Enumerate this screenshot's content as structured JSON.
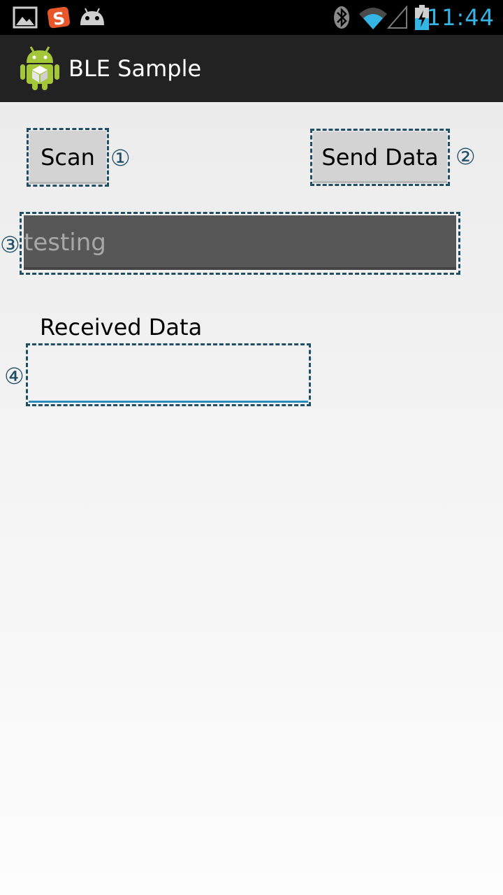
{
  "status_bar": {
    "time": "11:44",
    "left_icons": [
      "gallery-icon",
      "sougou-ime-icon",
      "android-debug-icon"
    ],
    "right_icons": [
      "bluetooth-icon",
      "wifi-icon",
      "signal-icon",
      "battery-charging-icon"
    ],
    "time_color": "#33b5e5"
  },
  "action_bar": {
    "title": "BLE Sample",
    "icon": "android-app-icon",
    "background": "#222222"
  },
  "main": {
    "scan_button": "Scan",
    "scan_marker": "①",
    "send_button": "Send Data",
    "send_marker": "②",
    "input_marker": "③",
    "input_value": "testing",
    "received_label": "Received Data",
    "received_marker": "④",
    "received_value": "",
    "annotation_color": "#1f4e66",
    "field_underline_color": "#2a8bbf"
  }
}
